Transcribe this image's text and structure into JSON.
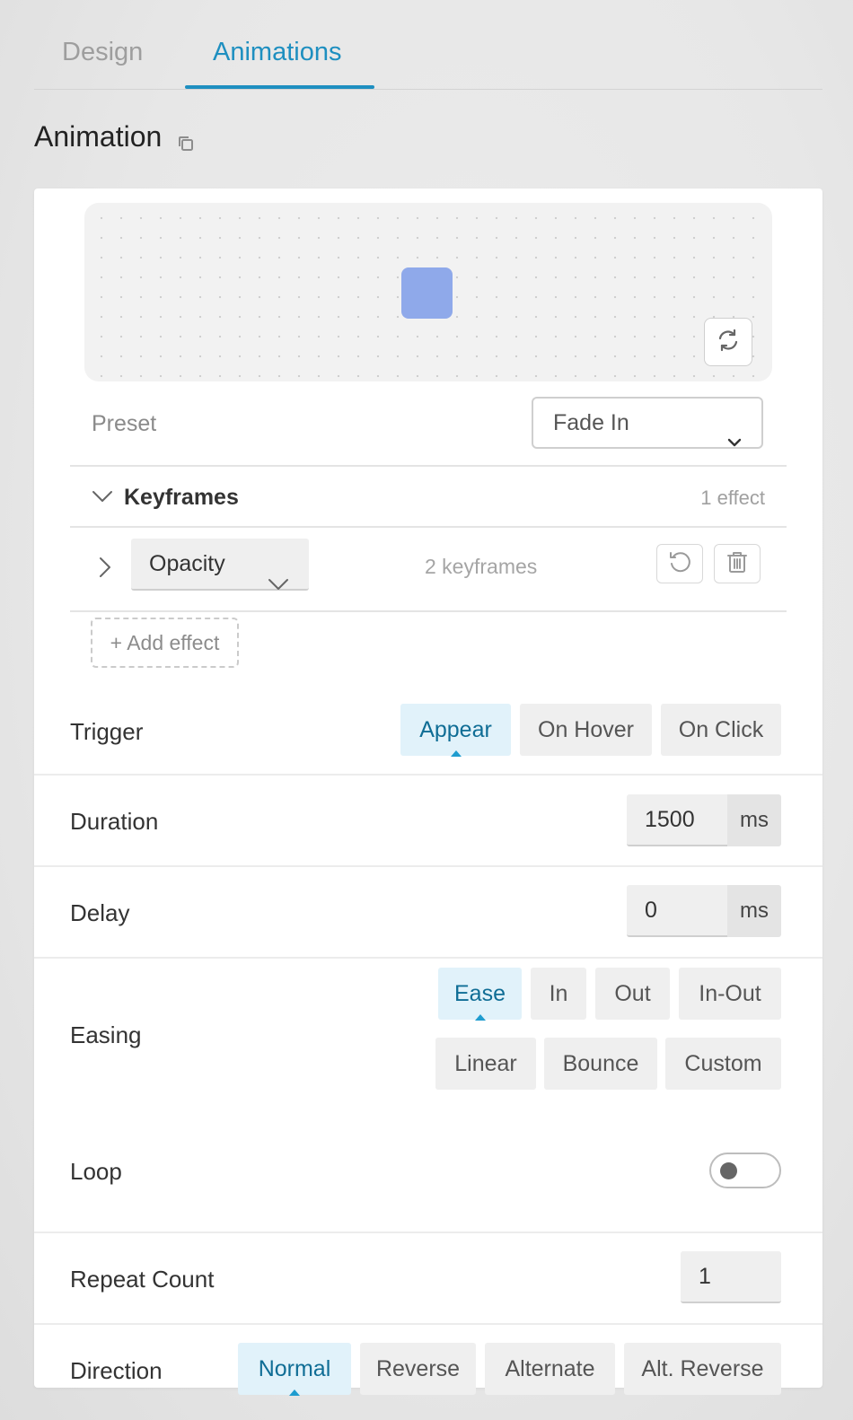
{
  "tabs": [
    {
      "label": "Design",
      "active": false
    },
    {
      "label": "Animations",
      "active": true
    }
  ],
  "section": {
    "title": "Animation",
    "copy_icon": "copy-icon"
  },
  "preview": {
    "box_color": "#8fa9ea",
    "replay_icon": "refresh-icon"
  },
  "preset": {
    "label": "Preset",
    "value": "Fade In"
  },
  "keyframes": {
    "title": "Keyframes",
    "count": "1 effect"
  },
  "effect": {
    "property": "Opacity",
    "count": "2 keyframes",
    "reset_icon": "undo-icon",
    "delete_icon": "trash-icon"
  },
  "add_effect": "+ Add effect",
  "trigger": {
    "label": "Trigger",
    "options": [
      "Appear",
      "On Hover",
      "On Click"
    ],
    "selected": "Appear"
  },
  "duration": {
    "label": "Duration",
    "value": "1500",
    "unit": "ms"
  },
  "delay": {
    "label": "Delay",
    "value": "0",
    "unit": "ms"
  },
  "easing": {
    "label": "Easing",
    "options": [
      "Ease",
      "In",
      "Out",
      "In-Out",
      "Linear",
      "Bounce",
      "Custom"
    ],
    "selected": "Ease"
  },
  "loop": {
    "label": "Loop",
    "enabled": false
  },
  "repeat_count": {
    "label": "Repeat Count",
    "value": "1"
  },
  "direction": {
    "label": "Direction",
    "options": [
      "Normal",
      "Reverse",
      "Alternate",
      "Alt. Reverse"
    ],
    "selected": "Normal"
  },
  "colors": {
    "accent": "#1e8fc0",
    "active_chip_bg": "#e1f2fa",
    "active_chip_text": "#0f6d95"
  }
}
